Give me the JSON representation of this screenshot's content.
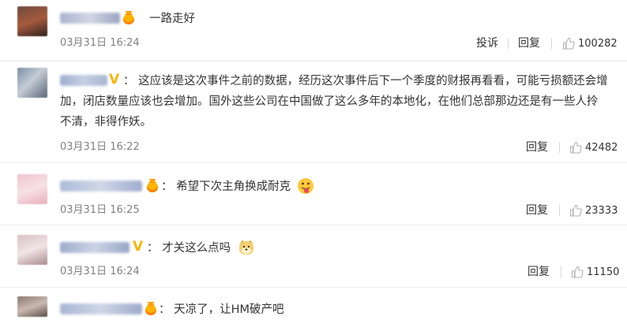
{
  "comments": [
    {
      "text": "一路走好",
      "time": "03月31日 16:24",
      "actions": [
        "投诉",
        "回复"
      ],
      "likes": "100282",
      "badge": "crown-badge-icon"
    },
    {
      "text_lines": [
        "：  这应该是这次事件之前的数据，经历这次事件后下一个季度的财报再看看，可能亏损额还会增",
        "加，闭店数量应该也会增加。国外这些公司在中国做了这么多年的本地化，在他们总部那边还是有一些人拎",
        "不清，非得作妖。"
      ],
      "time": "03月31日 16:22",
      "actions": [
        "回复"
      ],
      "likes": "42482",
      "badge_text": "V"
    },
    {
      "text": "：  希望下次主角换成耐克",
      "time": "03月31日 16:25",
      "actions": [
        "回复"
      ],
      "likes": "23333",
      "emoji": "tongue-emoji-icon"
    },
    {
      "text": "：  才关这么点吗",
      "time": "03月31日 16:24",
      "actions": [
        "回复"
      ],
      "likes": "11150",
      "badge_text": "V",
      "emoji": "doge-emoji-icon"
    },
    {
      "text": "：  天凉了，让HM破产吧"
    }
  ],
  "colors": {
    "badge_orange": "#ffb300",
    "vip_gold": "#f7b500",
    "time_gray": "#808080",
    "like_gray": "#b0b0b0"
  }
}
